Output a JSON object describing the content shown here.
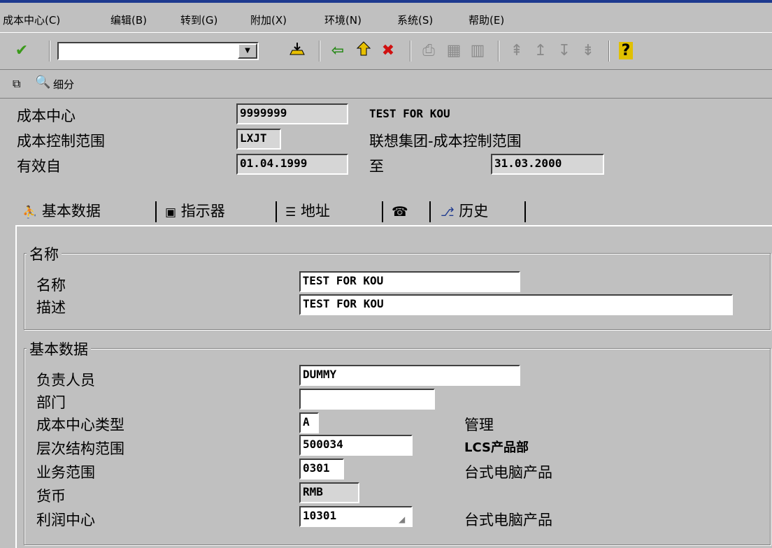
{
  "menu": [
    "成本中心(C)",
    "编辑(B)",
    "转到(G)",
    "附加(X)",
    "环境(N)",
    "系统(S)",
    "帮助(E)"
  ],
  "toolbar": {
    "command_value": "",
    "help_glyph": "?"
  },
  "appbar": {
    "detail_label": "细分"
  },
  "header": {
    "cost_center_label": "成本中心",
    "cost_center_value": "9999999",
    "cost_center_name": "TEST FOR KOU",
    "controlling_area_label": "成本控制范围",
    "controlling_area_value": "LXJT",
    "controlling_area_name": "联想集团-成本控制范围",
    "valid_from_label": "有效自",
    "valid_from_value": "01.04.1999",
    "valid_to_label": "至",
    "valid_to_value": "31.03.2000"
  },
  "tabs": [
    {
      "label": "基本数据",
      "icon": "person-icon"
    },
    {
      "label": "指示器",
      "icon": "indicator-icon"
    },
    {
      "label": "地址",
      "icon": "address-icon"
    },
    {
      "label": "",
      "icon": "phone-icon"
    },
    {
      "label": "历史",
      "icon": "history-icon"
    }
  ],
  "names_group": {
    "title": "名称",
    "name_label": "名称",
    "name_value": "TEST FOR KOU",
    "description_label": "描述",
    "description_value": "TEST FOR KOU"
  },
  "basic_group": {
    "title": "基本数据",
    "person_label": "负责人员",
    "person_value": "DUMMY",
    "department_label": "部门",
    "department_value": "",
    "category_label": "成本中心类型",
    "category_value": "A",
    "category_text": "管理",
    "hierarchy_label": "层次结构范围",
    "hierarchy_value": "500034",
    "hierarchy_text": "LCS产品部",
    "business_area_label": "业务范围",
    "business_area_value": "0301",
    "business_area_text": "台式电脑产品",
    "currency_label": "货币",
    "currency_value": "RMB",
    "profit_center_label": "利润中心",
    "profit_center_value": "10301",
    "profit_center_text": "台式电脑产品"
  },
  "colors": {
    "title_bar": "#1e3a8f",
    "check": "#3a9a1a",
    "cancel": "#d01010",
    "help": "#e0c000"
  }
}
